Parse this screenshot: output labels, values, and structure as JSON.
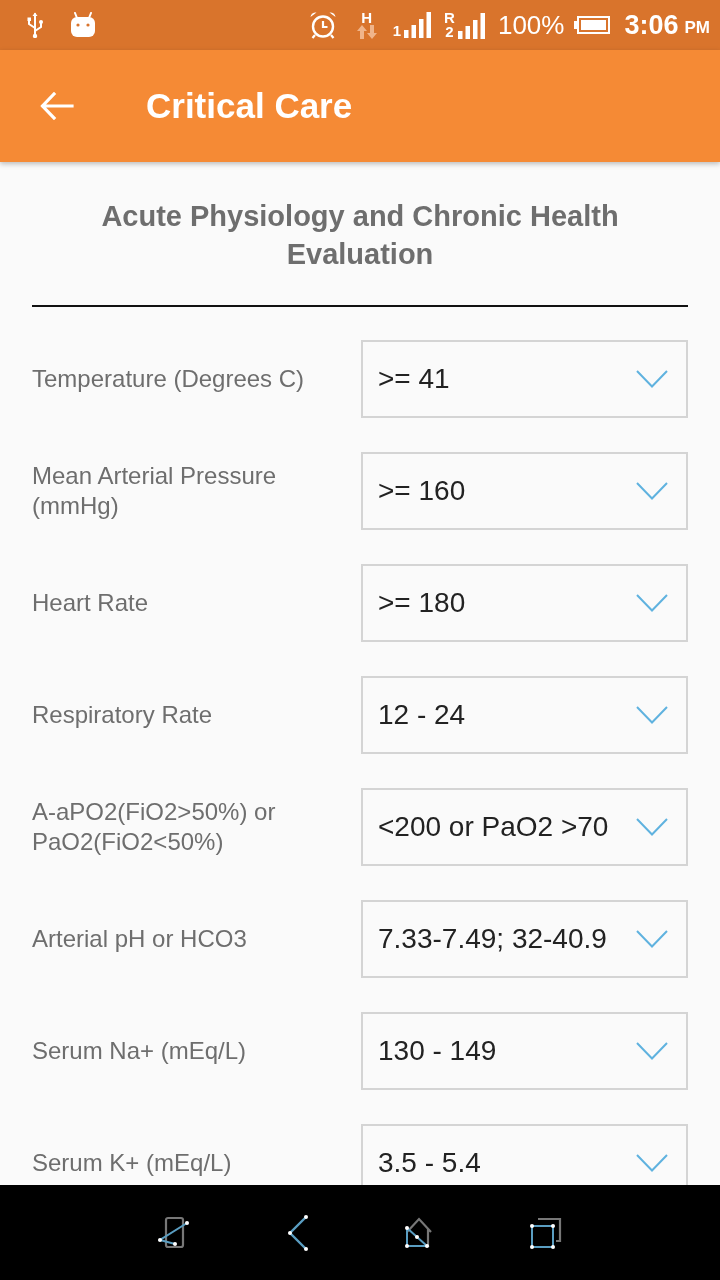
{
  "status_bar": {
    "network_type": "H",
    "sim_1_signal": "1",
    "roaming": "R",
    "sim_2_signal": "2",
    "battery": "100%",
    "time": "3:06",
    "time_suffix": "PM"
  },
  "app_bar": {
    "title": "Critical Care"
  },
  "form": {
    "title": "Acute Physiology and Chronic Health Evaluation",
    "fields": [
      {
        "label": "Temperature (Degrees C)",
        "value": ">= 41"
      },
      {
        "label": "Mean Arterial Pressure (mmHg)",
        "value": ">= 160"
      },
      {
        "label": "Heart Rate",
        "value": ">= 180"
      },
      {
        "label": "Respiratory Rate",
        "value": "12 - 24"
      },
      {
        "label": "A-aPO2(FiO2>50%) or PaO2(FiO2<50%)",
        "value": "<200 or PaO2 >70"
      },
      {
        "label": "Arterial pH or HCO3",
        "value": "7.33-7.49; 32-40.9"
      },
      {
        "label": "Serum Na+ (mEq/L)",
        "value": "130 - 149"
      },
      {
        "label": "Serum K+ (mEq/L)",
        "value": "3.5 - 5.4"
      }
    ]
  }
}
